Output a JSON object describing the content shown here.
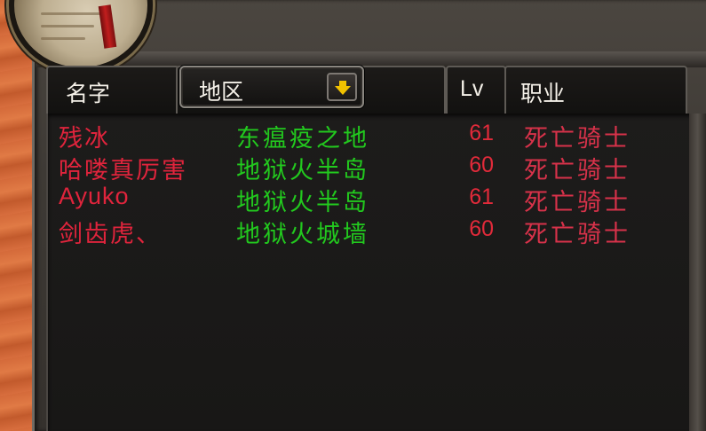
{
  "header": {
    "col_name": "名字",
    "col_zone": "地区",
    "col_level": "Lv",
    "col_class": "职业"
  },
  "rows": [
    {
      "name": "残冰",
      "zone": "东瘟疫之地",
      "level": "61",
      "class": "死亡骑士"
    },
    {
      "name": "哈喽真厉害",
      "zone": "地狱火半岛",
      "level": "60",
      "class": "死亡骑士"
    },
    {
      "name": "Ayuko",
      "zone": "地狱火半岛",
      "level": "61",
      "class": "死亡骑士"
    },
    {
      "name": "剑齿虎、",
      "zone": "地狱火城墙",
      "level": "60",
      "class": "死亡骑士"
    }
  ],
  "colors": {
    "name": "#e0243c",
    "zone": "#22c91e",
    "level": "#e22a3a",
    "class": "#d8324a",
    "dropdown_arrow": "#f2c200"
  },
  "icons": {
    "dropdown": "chevron-down-icon",
    "portrait": "scroll-portrait-icon"
  }
}
